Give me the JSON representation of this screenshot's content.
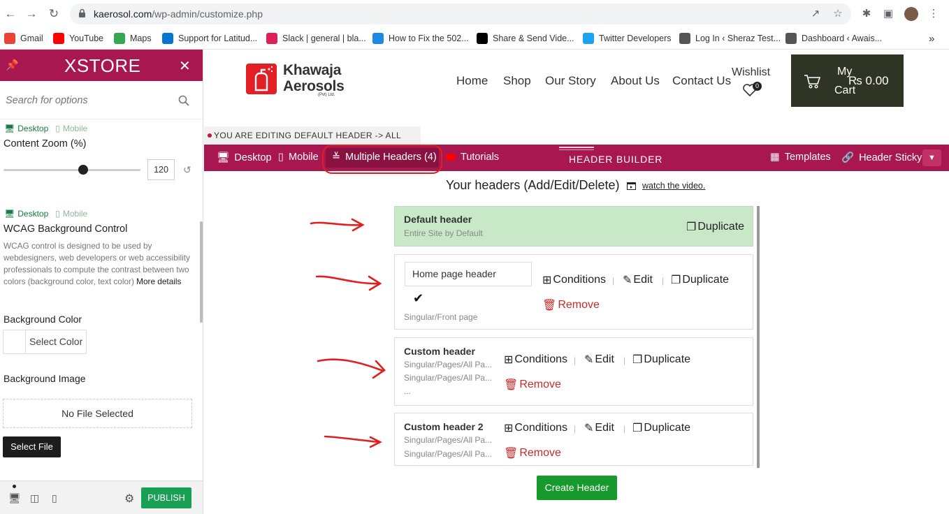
{
  "browser": {
    "url_host": "kaerosol.com",
    "url_path": "/wp-admin/customize.php",
    "bookmarks": [
      {
        "label": "Gmail",
        "icon": "gmail-icon",
        "color": "#ea4335"
      },
      {
        "label": "YouTube",
        "icon": "youtube-icon",
        "color": "#ff0000"
      },
      {
        "label": "Maps",
        "icon": "maps-icon",
        "color": "#34a853"
      },
      {
        "label": "Support for Latitud...",
        "icon": "dell-icon",
        "color": "#0076ce"
      },
      {
        "label": "Slack | general | bla...",
        "icon": "slack-icon",
        "color": "#e01e5a"
      },
      {
        "label": "How to Fix the 502...",
        "icon": "globe-icon",
        "color": "#1e88e5"
      },
      {
        "label": "Share & Send Vide...",
        "icon": "vimeo-icon",
        "color": "#000000"
      },
      {
        "label": "Twitter Developers",
        "icon": "twitter-icon",
        "color": "#1da1f2"
      },
      {
        "label": "Log In ‹ Sheraz Test...",
        "icon": "wordpress-icon",
        "color": "#555555"
      },
      {
        "label": "Dashboard ‹ Awais...",
        "icon": "wordpress-icon",
        "color": "#555555"
      }
    ],
    "more_bookmarks": "»"
  },
  "panel": {
    "brand": "XSTORE",
    "search_placeholder": "Search for options",
    "device_desktop": "Desktop",
    "device_mobile": "Mobile",
    "content_zoom_title": "Content Zoom (%)",
    "content_zoom_value": "120",
    "content_zoom_level": 0.58,
    "wcag_title": "WCAG Background Control",
    "wcag_desc": "WCAG control is designed to be used by webdesigners, web developers or web accessibility professionals to compute the contrast between two colors (background color, text color)",
    "wcag_more": "More details",
    "bg_color_label": "Background Color",
    "select_color": "Select Color",
    "bg_image_label": "Background Image",
    "no_file": "No File Selected",
    "select_file": "Select File",
    "publish": "PUBLISH"
  },
  "site": {
    "logo_line1": "Khawaja",
    "logo_line2": "Aerosols",
    "logo_sub": "(Pvt) Ltd.",
    "nav": [
      "Home",
      "Shop",
      "Our Story",
      "About Us",
      "Contact Us"
    ],
    "wishlist": "Wishlist",
    "wishlist_count": "0",
    "cart_my": "My",
    "cart_cart": "Cart",
    "cart_total": "₨ 0.00"
  },
  "builder": {
    "editing_notice": "YOU ARE EDITING DEFAULT HEADER -> ALL SITE",
    "desktop": "Desktop",
    "mobile": "Mobile",
    "multiple_headers": "Multiple Headers (4)",
    "tutorials": "Tutorials",
    "title": "HEADER BUILDER",
    "templates": "Templates",
    "header_sticky": "Header Sticky",
    "your_headers": "Your headers (Add/Edit/Delete)",
    "watch_video": "watch the video.",
    "create_header": "Create Header",
    "actions": {
      "conditions": "Conditions",
      "edit": "Edit",
      "duplicate": "Duplicate",
      "remove": "Remove"
    },
    "headers": [
      {
        "name": "Default header",
        "conditions": [
          "Entire Site by Default"
        ]
      },
      {
        "name": "Home page header",
        "conditions": [
          "Singular/Front page"
        ]
      },
      {
        "name": "Custom header",
        "conditions": [
          "Singular/Pages/All Pa...",
          "Singular/Pages/All Pa...",
          "..."
        ]
      },
      {
        "name": "Custom header 2",
        "conditions": [
          "Singular/Pages/All Pa...",
          "Singular/Pages/All Pa..."
        ]
      }
    ]
  },
  "colors": {
    "brand": "#a8174f",
    "publish_green": "#1aa054",
    "create_green": "#159a2b",
    "default_card": "#c8e8c8",
    "remove_red": "#c52a2a",
    "annotation_red": "#e0201f"
  }
}
